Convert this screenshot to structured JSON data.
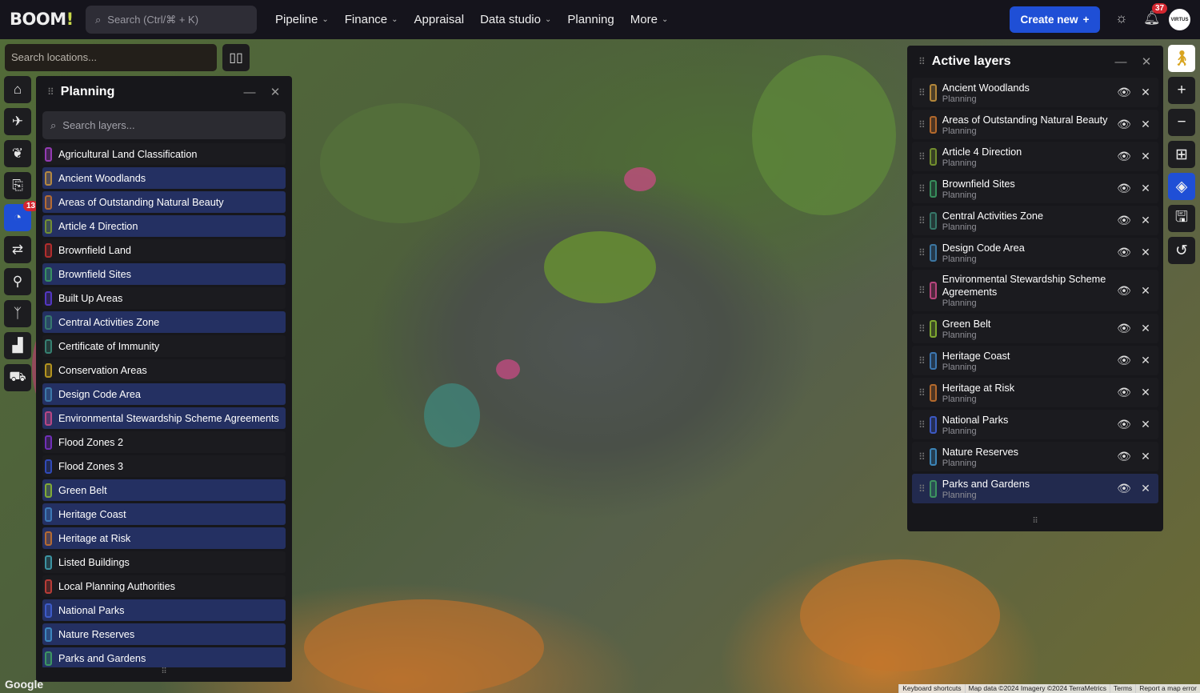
{
  "header": {
    "logo": "BOOM!",
    "search_placeholder": "Search (Ctrl/⌘ + K)",
    "nav": [
      {
        "label": "Pipeline",
        "dropdown": true
      },
      {
        "label": "Finance",
        "dropdown": true
      },
      {
        "label": "Appraisal",
        "dropdown": false
      },
      {
        "label": "Data studio",
        "dropdown": true
      },
      {
        "label": "Planning",
        "dropdown": false
      },
      {
        "label": "More",
        "dropdown": true
      }
    ],
    "create_label": "Create new",
    "notification_count": "37",
    "avatar_text": "VIRTUS"
  },
  "map": {
    "search_placeholder": "Search locations...",
    "attribution": [
      "Keyboard shortcuts",
      "Map data ©2024 Imagery ©2024 TerraMetrics",
      "Terms",
      "Report a map error"
    ],
    "google": "Google"
  },
  "rail": {
    "active_badge": "13",
    "items": [
      "home",
      "drone",
      "leaf",
      "document-search",
      "radar",
      "route",
      "person-pin",
      "pylon",
      "chart",
      "car"
    ]
  },
  "planning": {
    "title": "Planning",
    "search_placeholder": "Search layers...",
    "items": [
      {
        "label": "Agricultural Land Classification",
        "color": "#a23fc4",
        "active": false
      },
      {
        "label": "Ancient Woodlands",
        "color": "#c4923e",
        "active": true
      },
      {
        "label": "Areas of Outstanding Natural Beauty",
        "color": "#c4722e",
        "active": true
      },
      {
        "label": "Article 4 Direction",
        "color": "#7c9a30",
        "active": true
      },
      {
        "label": "Brownfield Land",
        "color": "#c2302f",
        "active": false
      },
      {
        "label": "Brownfield Sites",
        "color": "#3b9a62",
        "active": true
      },
      {
        "label": "Built Up Areas",
        "color": "#5a3bd4",
        "active": false
      },
      {
        "label": "Central Activities Zone",
        "color": "#3a8070",
        "active": true
      },
      {
        "label": "Certificate of Immunity",
        "color": "#3a8a7a",
        "active": false
      },
      {
        "label": "Conservation Areas",
        "color": "#c4a020",
        "active": false
      },
      {
        "label": "Design Code Area",
        "color": "#4080b0",
        "active": true
      },
      {
        "label": "Environmental Stewardship Scheme Agreements",
        "color": "#c84a88",
        "active": true
      },
      {
        "label": "Flood Zones 2",
        "color": "#7a32c8",
        "active": false
      },
      {
        "label": "Flood Zones 3",
        "color": "#3450c8",
        "active": false
      },
      {
        "label": "Green Belt",
        "color": "#8ab832",
        "active": true
      },
      {
        "label": "Heritage Coast",
        "color": "#4080c0",
        "active": true
      },
      {
        "label": "Heritage at Risk",
        "color": "#c4722e",
        "active": true
      },
      {
        "label": "Listed Buildings",
        "color": "#40a0b0",
        "active": false
      },
      {
        "label": "Local Planning Authorities",
        "color": "#c8403a",
        "active": false
      },
      {
        "label": "National Parks",
        "color": "#4060d4",
        "active": true
      },
      {
        "label": "Nature Reserves",
        "color": "#4090c8",
        "active": true
      },
      {
        "label": "Parks and Gardens",
        "color": "#40a062",
        "active": true
      }
    ]
  },
  "active_layers": {
    "title": "Active layers",
    "items": [
      {
        "label": "Ancient Woodlands",
        "category": "Planning",
        "color": "#c4923e"
      },
      {
        "label": "Areas of Outstanding Natural Beauty",
        "category": "Planning",
        "color": "#c4722e"
      },
      {
        "label": "Article 4 Direction",
        "category": "Planning",
        "color": "#7c9a30"
      },
      {
        "label": "Brownfield Sites",
        "category": "Planning",
        "color": "#3b9a62"
      },
      {
        "label": "Central Activities Zone",
        "category": "Planning",
        "color": "#3a8070"
      },
      {
        "label": "Design Code Area",
        "category": "Planning",
        "color": "#4080b0"
      },
      {
        "label": "Environmental Stewardship Scheme Agreements",
        "category": "Planning",
        "color": "#c84a88"
      },
      {
        "label": "Green Belt",
        "category": "Planning",
        "color": "#8ab832"
      },
      {
        "label": "Heritage Coast",
        "category": "Planning",
        "color": "#4080c0"
      },
      {
        "label": "Heritage at Risk",
        "category": "Planning",
        "color": "#c4722e"
      },
      {
        "label": "National Parks",
        "category": "Planning",
        "color": "#4060d4"
      },
      {
        "label": "Nature Reserves",
        "category": "Planning",
        "color": "#4090c8"
      },
      {
        "label": "Parks and Gardens",
        "category": "Planning",
        "color": "#40a062"
      }
    ]
  },
  "right_rail": [
    "street-view",
    "zoom-in",
    "zoom-out",
    "grid",
    "layers",
    "save",
    "history"
  ]
}
